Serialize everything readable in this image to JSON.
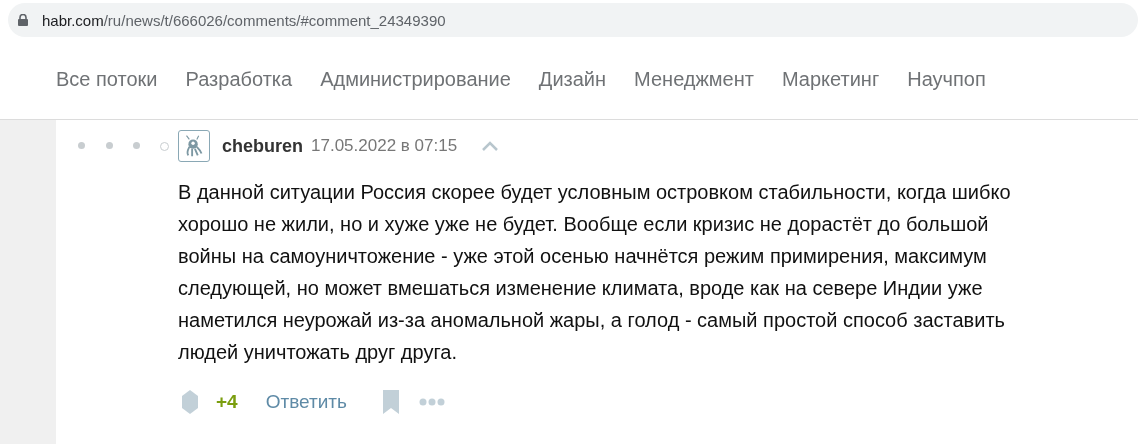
{
  "address_bar": {
    "host": "habr.com",
    "path": "/ru/news/t/666026/comments/#comment_24349390"
  },
  "nav": {
    "items": [
      {
        "label": "Все потоки"
      },
      {
        "label": "Разработка"
      },
      {
        "label": "Администрирование"
      },
      {
        "label": "Дизайн"
      },
      {
        "label": "Менеджмент"
      },
      {
        "label": "Маркетинг"
      },
      {
        "label": "Научпоп"
      }
    ]
  },
  "comment": {
    "thread_markers": [
      {
        "kind": "dot"
      },
      {
        "kind": "dot"
      },
      {
        "kind": "dot"
      },
      {
        "kind": "ring"
      }
    ],
    "author": "cheburen",
    "date": "17.05.2022 в 07:15",
    "text": "В данной ситуации Россия скорее будет условным островком стабильности, когда шибко хорошо не жили, но и хуже уже не будет. Вообще если кризис не дорастёт до большой войны на самоуничтожение - уже этой осенью начнётся режим примирения, максимум следующей, но может вмешаться изменение климата, вроде как на севере Индии уже наметился неурожай из-за аномальной жары, а голод - самый простой способ заставить людей уничтожать друг друга.",
    "score": "+4",
    "reply": "Ответить"
  }
}
